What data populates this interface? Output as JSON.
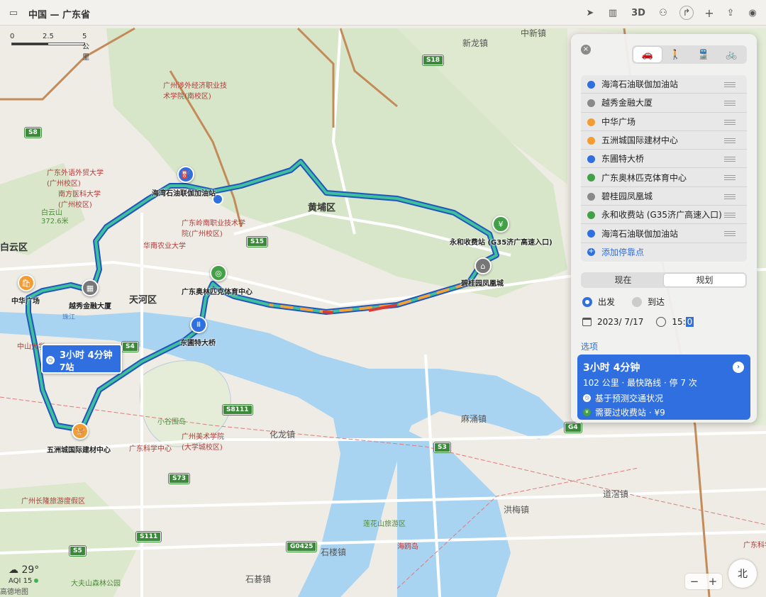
{
  "window": {
    "title": "中国 — 广东省"
  },
  "toolbar": {
    "three_d": "3D"
  },
  "scale": {
    "marks": [
      "0",
      "2.5",
      "5 公里"
    ]
  },
  "weather": {
    "temp": "29°",
    "aqi": "AQI 15"
  },
  "attribution": "高德地图",
  "compass": "北",
  "zoom": {
    "minus": "−",
    "plus": "+"
  },
  "callout": {
    "duration": "3小时 4分钟",
    "stops": "7站"
  },
  "map_labels": {
    "districts": [
      "黄埔区",
      "天河区",
      "白云区"
    ],
    "towns": [
      "新龙镇",
      "中新镇",
      "化龙镇",
      "麻涌镇",
      "洪梅镇",
      "道滘镇",
      "石楼镇",
      "石碁镇"
    ],
    "pois": [
      "广州涉外经济职业技术学院(南校区)",
      "广东外语外贸大学(广州校区)",
      "南方医科大学(广州校区)",
      "白云山",
      "372.6米",
      "广东岭南职业技术学院(广州校区)",
      "华南农业大学",
      "中山大学",
      "珠江",
      "小谷围岛",
      "广州美术学院(大学城校区)",
      "广东科学中心",
      "广州长隆旅游度假区",
      "莲花山旅游区",
      "海鸥岛",
      "大夫山森林公园",
      "广东科学"
    ],
    "roads": [
      "S18",
      "S8",
      "S15",
      "S4",
      "S8111",
      "S73",
      "S3",
      "G4",
      "S111",
      "S5",
      "G0425"
    ]
  },
  "pins": [
    {
      "label": "海湾石油联伽加油站",
      "color": "#2f6fe0",
      "icon": "fuel-icon"
    },
    {
      "label": "永和收费站 (G35济广高速入口)",
      "color": "#43a047",
      "icon": "yen-icon"
    },
    {
      "label": "碧桂园凤凰城",
      "color": "#777777",
      "icon": "home-icon"
    },
    {
      "label": "广东奥林匹克体育中心",
      "color": "#43a047",
      "icon": "stadium-icon"
    },
    {
      "label": "东圃特大桥",
      "color": "#2f6fe0",
      "icon": "bridge-icon"
    },
    {
      "label": "越秀金融大厦",
      "color": "#777777",
      "icon": "building-icon"
    },
    {
      "label": "中华广场",
      "color": "#f39c34",
      "icon": "shopping-icon"
    },
    {
      "label": "五洲城国际建材中心",
      "color": "#f39c34",
      "icon": "basket-icon"
    }
  ],
  "panel": {
    "close": "×",
    "modes": [
      {
        "name": "car",
        "glyph": "🚗"
      },
      {
        "name": "walk",
        "glyph": "🚶"
      },
      {
        "name": "transit",
        "glyph": "🚆"
      },
      {
        "name": "bike",
        "glyph": "🚲"
      }
    ],
    "stops": [
      {
        "label": "海湾石油联伽加油站",
        "color": "#2f6fe0"
      },
      {
        "label": "越秀金融大厦",
        "color": "#8a8a8a"
      },
      {
        "label": "中华广场",
        "color": "#f39c34"
      },
      {
        "label": "五洲城国际建材中心",
        "color": "#f39c34"
      },
      {
        "label": "东圃特大桥",
        "color": "#2f6fe0"
      },
      {
        "label": "广东奥林匹克体育中心",
        "color": "#43a047"
      },
      {
        "label": "碧桂园凤凰城",
        "color": "#8a8a8a"
      },
      {
        "label": "永和收费站 (G35济广高速入口)",
        "color": "#43a047"
      },
      {
        "label": "海湾石油联伽加油站",
        "color": "#2f6fe0"
      }
    ],
    "add_stop": "添加停靠点",
    "segments": [
      "现在",
      "规划"
    ],
    "radios": {
      "depart": "出发",
      "arrive": "到达"
    },
    "date": "2023/  7/17",
    "time_hour": "15:",
    "time_min": "0",
    "options": "选项",
    "route": {
      "duration": "3小时 4分钟",
      "detail": "102 公里 · 最快路线 · 停 7 次",
      "note1": "基于预测交通状况",
      "note2": "需要过收费站 · ¥9"
    }
  },
  "colors": {
    "route": "#2f6fe0",
    "accent": "#2f6fe0",
    "toll_green": "#43a047"
  }
}
